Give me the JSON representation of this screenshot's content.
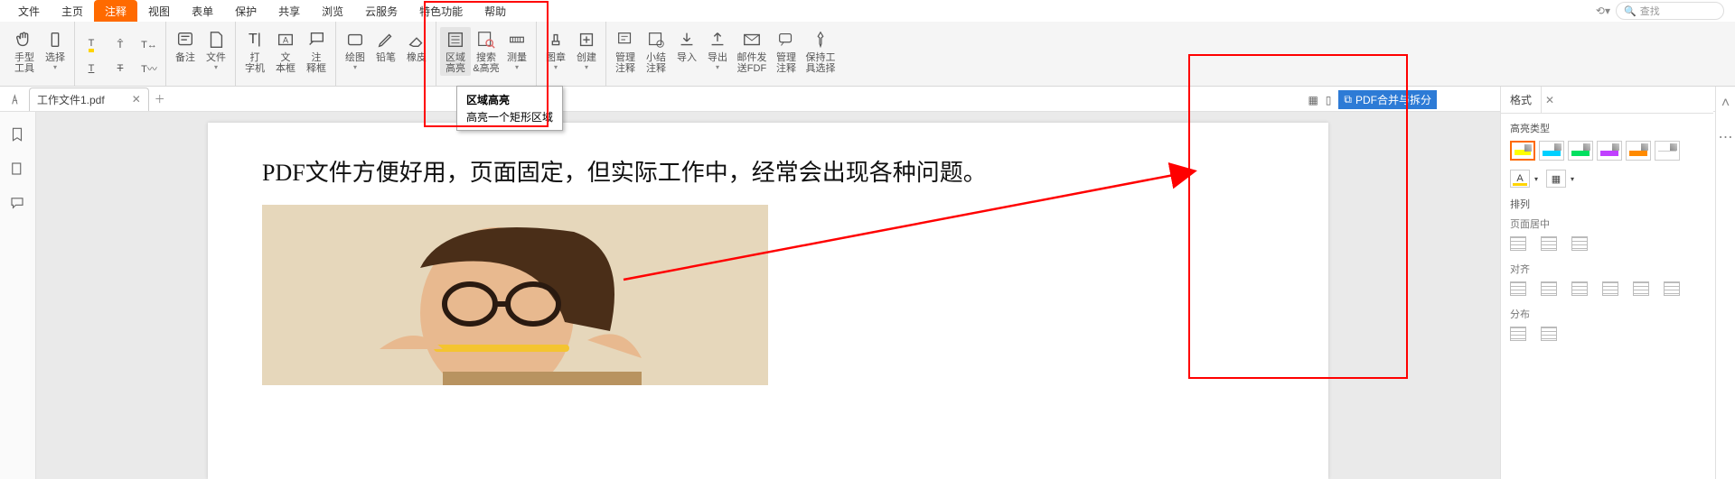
{
  "menu": {
    "items": [
      "文件",
      "主页",
      "注释",
      "视图",
      "表单",
      "保护",
      "共享",
      "浏览",
      "云服务",
      "特色功能",
      "帮助"
    ],
    "active_index": 2,
    "search_placeholder": "查找"
  },
  "ribbon": {
    "groups": [
      {
        "type": "col",
        "items": [
          {
            "label": "手型\n工具",
            "name": "hand-tool",
            "icon": "hand"
          },
          {
            "label": "选择",
            "name": "select-tool",
            "icon": "cursor",
            "drop": true
          }
        ]
      },
      {
        "type": "textmark",
        "row1": [
          {
            "name": "highlight",
            "icon": "T-hl"
          },
          {
            "name": "caret",
            "icon": "T-caret"
          },
          {
            "name": "replace",
            "icon": "T-rep"
          }
        ],
        "row2": [
          {
            "name": "underline",
            "icon": "T-ul"
          },
          {
            "name": "strike",
            "icon": "T-strike"
          },
          {
            "name": "squiggly",
            "icon": "T-sq"
          }
        ]
      },
      {
        "type": "col",
        "items": [
          {
            "label": "备注",
            "name": "note-button",
            "icon": "note"
          },
          {
            "label": "文件",
            "name": "file-attach-button",
            "icon": "file",
            "drop": true
          }
        ]
      },
      {
        "type": "col",
        "items": [
          {
            "label": "打\n字机",
            "name": "typewriter-button",
            "icon": "type"
          },
          {
            "label": "文\n本框",
            "name": "textbox-button",
            "icon": "textbox"
          },
          {
            "label": "注\n释框",
            "name": "callout-button",
            "icon": "callout"
          }
        ]
      },
      {
        "type": "col",
        "items": [
          {
            "label": "绘图",
            "name": "draw-button",
            "icon": "rect",
            "drop": true
          },
          {
            "label": "铅笔",
            "name": "pencil-button",
            "icon": "pencil"
          },
          {
            "label": "橡皮",
            "name": "eraser-button",
            "icon": "eraser"
          }
        ]
      },
      {
        "type": "col",
        "items": [
          {
            "label": "区域\n高亮",
            "name": "area-highlight-button",
            "icon": "area-hl",
            "active": true
          },
          {
            "label": "搜索\n&高亮",
            "name": "search-highlight-button",
            "icon": "search-hl"
          },
          {
            "label": "测量",
            "name": "measure-button",
            "icon": "ruler",
            "drop": true
          }
        ]
      },
      {
        "type": "col",
        "items": [
          {
            "label": "图章",
            "name": "stamp-button",
            "icon": "stamp",
            "drop": true
          },
          {
            "label": "创建",
            "name": "create-button",
            "icon": "create",
            "drop": true
          }
        ]
      },
      {
        "type": "col",
        "items": [
          {
            "label": "管理\n注释",
            "name": "manage-comments-button",
            "icon": "manage"
          },
          {
            "label": "小结\n注释",
            "name": "summarize-button",
            "icon": "summary"
          },
          {
            "label": "导入",
            "name": "import-button",
            "icon": "import"
          },
          {
            "label": "导出",
            "name": "export-button",
            "icon": "export",
            "drop": true
          },
          {
            "label": "邮件发\n送FDF",
            "name": "email-fdf-button",
            "icon": "mail",
            "wide": true
          },
          {
            "label": "管理\n注释",
            "name": "comment-server-button",
            "icon": "serv"
          },
          {
            "label": "保持工\n具选择",
            "name": "keep-tool-button",
            "icon": "pin",
            "wide": true
          }
        ]
      }
    ]
  },
  "tooltip": {
    "title": "区域高亮",
    "desc": "高亮一个矩形区域"
  },
  "document": {
    "tab_name": "工作文件1.pdf",
    "text": "PDF文件方便好用，页面固定，但实际工作中，经常会出现各种问题。"
  },
  "viewbar": {
    "merge_label": "PDF合并与拆分"
  },
  "right_panel": {
    "tab": "格式",
    "highlight_section": "高亮类型",
    "colors": [
      "#ffff00",
      "#00d0ff",
      "#00e060",
      "#c040ff",
      "#ff8a00",
      "#ffffff"
    ],
    "selected_color_index": 0,
    "text_button": "A",
    "arrange_section": "排列",
    "page_center": "页面居中",
    "align": "对齐",
    "distribute": "分布"
  }
}
